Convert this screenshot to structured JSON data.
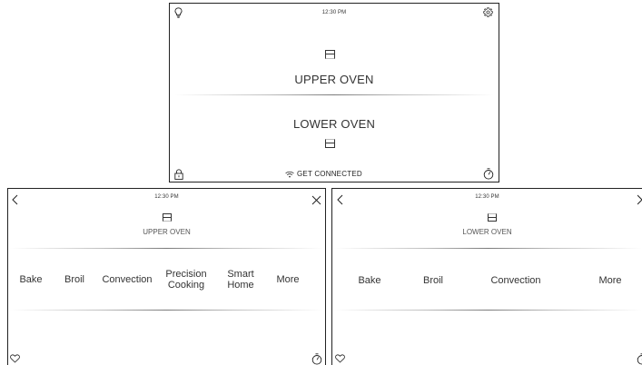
{
  "main_screen": {
    "time": "12:30 PM",
    "upper_label": "UPPER OVEN",
    "lower_label": "LOWER OVEN",
    "connect_label": "GET CONNECTED"
  },
  "upper_screen": {
    "time": "12:30 PM",
    "title": "UPPER OVEN",
    "menu": [
      "Bake",
      "Broil",
      "Convection",
      "Precision Cooking",
      "Smart Home",
      "More"
    ]
  },
  "lower_screen": {
    "time": "12:30 PM",
    "title": "LOWER OVEN",
    "menu": [
      "Bake",
      "Broil",
      "Convection",
      "More"
    ]
  }
}
